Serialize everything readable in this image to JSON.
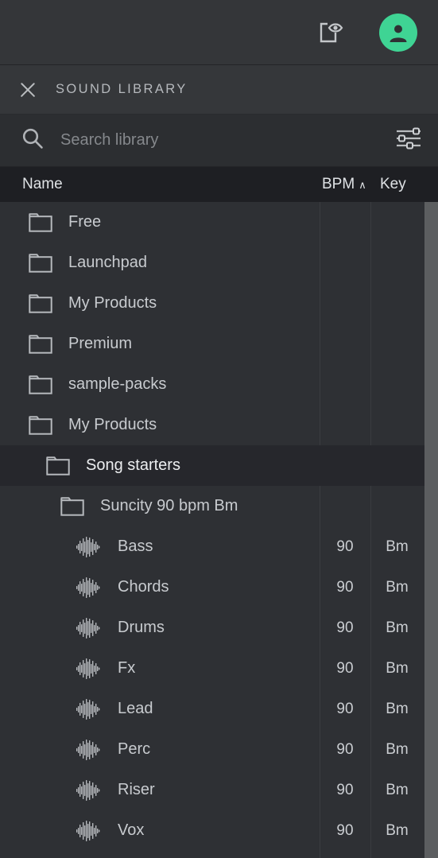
{
  "topbar": {
    "preview_icon": "square-eye-icon",
    "account_icon": "account-avatar-icon"
  },
  "panel": {
    "close_label": "close-icon",
    "title": "SOUND LIBRARY"
  },
  "search": {
    "placeholder": "Search library",
    "value": "",
    "search_icon": "search-icon",
    "filter_icon": "filter-sliders-icon"
  },
  "columns": {
    "name": "Name",
    "bpm": "BPM",
    "sort_indicator": "∧",
    "key": "Key"
  },
  "colors": {
    "accent_green": "#3fd494",
    "panel_bg": "#2e3034",
    "header_bg": "#1e1f23",
    "selected_row": "#26272c",
    "scrollbar": "#5c5e60"
  },
  "rows": [
    {
      "label": "Free",
      "icon": "folder-icon",
      "indent": 0,
      "bpm": "",
      "key": "",
      "selected": false
    },
    {
      "label": "Launchpad",
      "icon": "folder-icon",
      "indent": 0,
      "bpm": "",
      "key": "",
      "selected": false
    },
    {
      "label": "My Products",
      "icon": "folder-icon",
      "indent": 0,
      "bpm": "",
      "key": "",
      "selected": false
    },
    {
      "label": "Premium",
      "icon": "folder-icon",
      "indent": 0,
      "bpm": "",
      "key": "",
      "selected": false
    },
    {
      "label": "sample-packs",
      "icon": "folder-icon",
      "indent": 0,
      "bpm": "",
      "key": "",
      "selected": false
    },
    {
      "label": "My Products",
      "icon": "folder-icon",
      "indent": 0,
      "bpm": "",
      "key": "",
      "selected": false
    },
    {
      "label": "Song starters",
      "icon": "folder-icon",
      "indent": 1,
      "bpm": "",
      "key": "",
      "selected": true
    },
    {
      "label": "Suncity 90 bpm Bm",
      "icon": "folder-icon",
      "indent": 2,
      "bpm": "",
      "key": "",
      "selected": false
    },
    {
      "label": "Bass",
      "icon": "waveform-icon",
      "indent": 3,
      "bpm": "90",
      "key": "Bm",
      "selected": false
    },
    {
      "label": "Chords",
      "icon": "waveform-icon",
      "indent": 3,
      "bpm": "90",
      "key": "Bm",
      "selected": false
    },
    {
      "label": "Drums",
      "icon": "waveform-icon",
      "indent": 3,
      "bpm": "90",
      "key": "Bm",
      "selected": false
    },
    {
      "label": "Fx",
      "icon": "waveform-icon",
      "indent": 3,
      "bpm": "90",
      "key": "Bm",
      "selected": false
    },
    {
      "label": "Lead",
      "icon": "waveform-icon",
      "indent": 3,
      "bpm": "90",
      "key": "Bm",
      "selected": false
    },
    {
      "label": "Perc",
      "icon": "waveform-icon",
      "indent": 3,
      "bpm": "90",
      "key": "Bm",
      "selected": false
    },
    {
      "label": "Riser",
      "icon": "waveform-icon",
      "indent": 3,
      "bpm": "90",
      "key": "Bm",
      "selected": false
    },
    {
      "label": "Vox",
      "icon": "waveform-icon",
      "indent": 3,
      "bpm": "90",
      "key": "Bm",
      "selected": false
    }
  ]
}
